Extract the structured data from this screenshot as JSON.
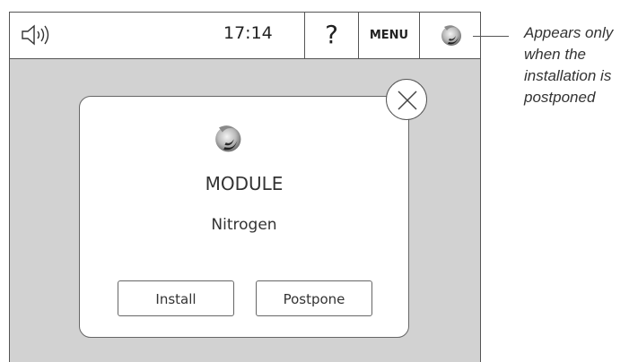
{
  "statusbar": {
    "time": "17:14",
    "help_label": "?",
    "menu_label": "MENU",
    "sound_icon": "speaker-icon",
    "module_icon": "module-icon"
  },
  "dialog": {
    "icon": "module-icon",
    "title": "MODULE",
    "subtitle": "Nitrogen",
    "install_label": "Install",
    "postpone_label": "Postpone",
    "close_icon": "close-icon"
  },
  "annotation": {
    "text": "Appears only when the installation is postponed"
  },
  "colors": {
    "screen_background": "#d2d2d2",
    "border": "#555555"
  }
}
